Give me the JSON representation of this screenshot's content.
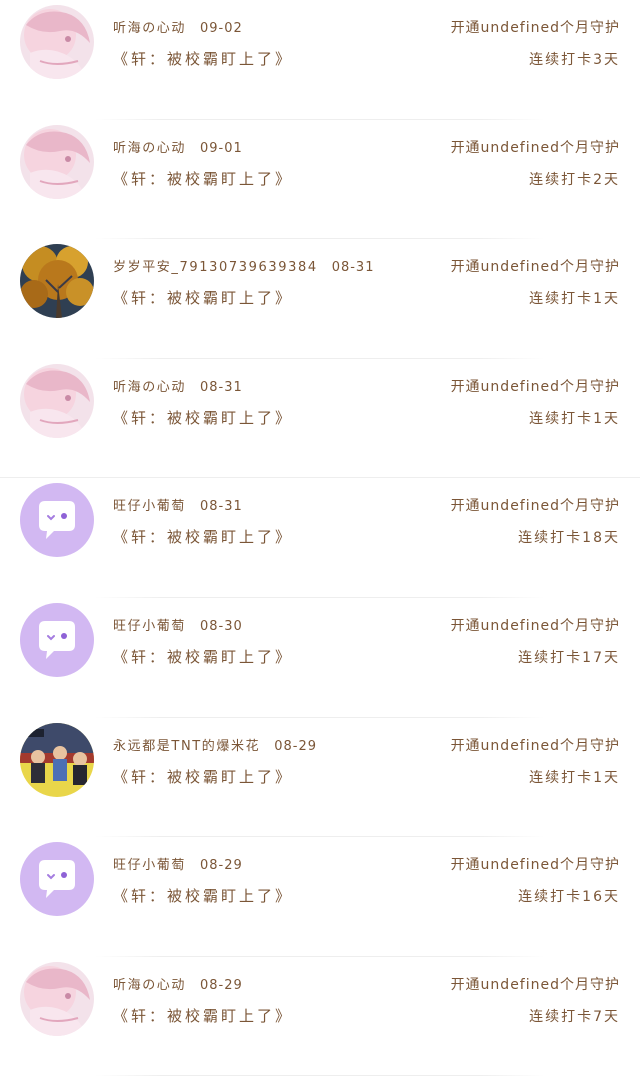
{
  "colors": {
    "text": "#7b5637",
    "chat_avatar_bg": "#d2b8f2",
    "divider": "#eeeeee"
  },
  "rows": [
    {
      "avatar": "anime-girl-avatar",
      "username": "听海の心动",
      "date": "09-02",
      "title": "《轩：被校霸盯上了》",
      "subscription": "开通undefined个月守护",
      "streak": "连续打卡3天"
    },
    {
      "avatar": "anime-girl-avatar",
      "username": "听海の心动",
      "date": "09-01",
      "title": "《轩：被校霸盯上了》",
      "subscription": "开通undefined个月守护",
      "streak": "连续打卡2天"
    },
    {
      "avatar": "golden-tree-avatar",
      "username": "岁岁平安_79130739639384",
      "date": "08-31",
      "title": "《轩：被校霸盯上了》",
      "subscription": "开通undefined个月守护",
      "streak": "连续打卡1天"
    },
    {
      "avatar": "anime-girl-avatar",
      "username": "听海の心动",
      "date": "08-31",
      "title": "《轩：被校霸盯上了》",
      "subscription": "开通undefined个月守护",
      "streak": "连续打卡1天"
    },
    {
      "avatar": "chat-bubble-avatar",
      "username": "旺仔小葡萄",
      "date": "08-31",
      "title": "《轩：被校霸盯上了》",
      "subscription": "开通undefined个月守护",
      "streak": "连续打卡18天"
    },
    {
      "avatar": "chat-bubble-avatar",
      "username": "旺仔小葡萄",
      "date": "08-30",
      "title": "《轩：被校霸盯上了》",
      "subscription": "开通undefined个月守护",
      "streak": "连续打卡17天"
    },
    {
      "avatar": "group-photo-avatar",
      "username": "永远都是TNT的爆米花",
      "date": "08-29",
      "title": "《轩：被校霸盯上了》",
      "subscription": "开通undefined个月守护",
      "streak": "连续打卡1天"
    },
    {
      "avatar": "chat-bubble-avatar",
      "username": "旺仔小葡萄",
      "date": "08-29",
      "title": "《轩：被校霸盯上了》",
      "subscription": "开通undefined个月守护",
      "streak": "连续打卡16天"
    },
    {
      "avatar": "anime-girl-avatar",
      "username": "听海の心动",
      "date": "08-29",
      "title": "《轩：被校霸盯上了》",
      "subscription": "开通undefined个月守护",
      "streak": "连续打卡7天"
    }
  ]
}
